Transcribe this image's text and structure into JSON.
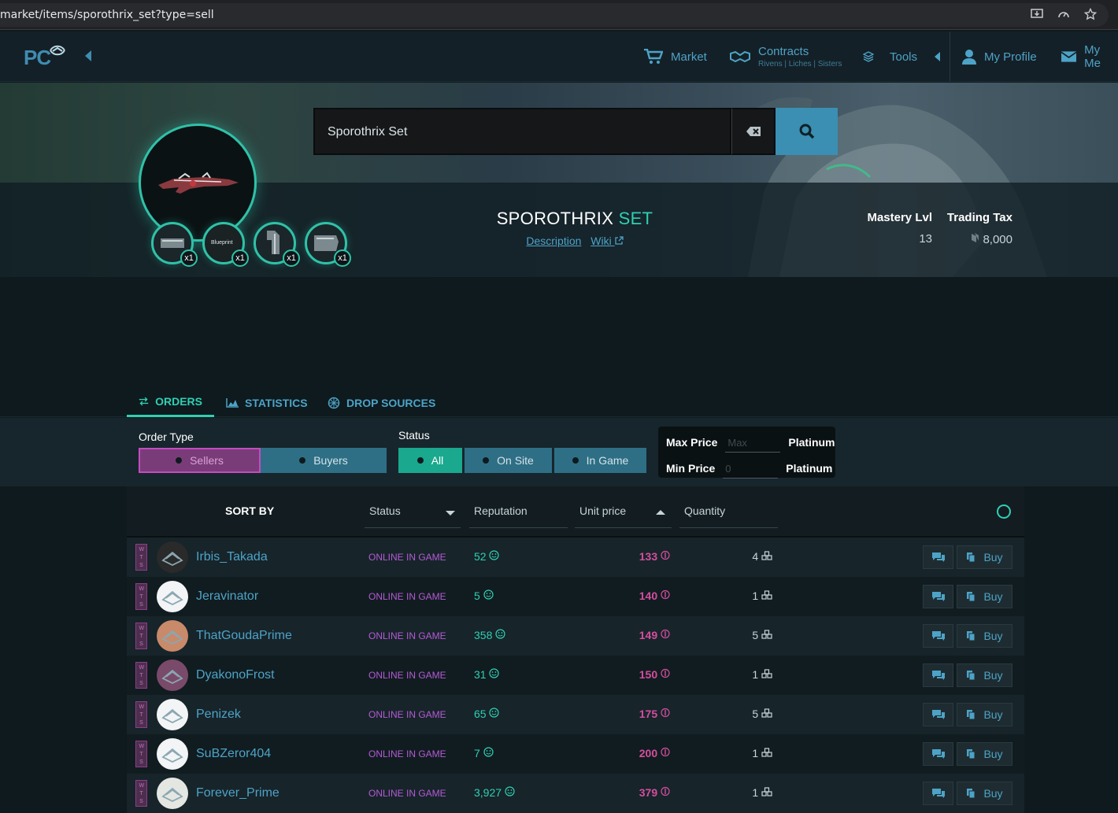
{
  "browser": {
    "url": "market/items/sporothrix_set?type=sell"
  },
  "nav": {
    "logo": "PC",
    "market": "Market",
    "contracts": "Contracts",
    "contracts_sub": "Rivens | Liches | Sisters",
    "tools": "Tools",
    "my_profile": "My Profile",
    "my_messages": "My Me"
  },
  "search": {
    "value": "Sporothrix Set"
  },
  "item": {
    "title_main": "SPOROTHRIX",
    "title_accent": "SET",
    "description_link": "Description",
    "wiki_link": "Wiki",
    "mastery_label": "Mastery Lvl",
    "mastery_value": "13",
    "tax_label": "Trading Tax",
    "tax_value": "8,000",
    "parts": [
      {
        "qty": "x1",
        "icon": "receiver-part-icon"
      },
      {
        "qty": "x1",
        "icon": "blueprint-part-icon",
        "text": "Blueprint"
      },
      {
        "qty": "x1",
        "icon": "stock-part-icon"
      },
      {
        "qty": "x1",
        "icon": "barrel-part-icon"
      }
    ]
  },
  "tabs": {
    "orders": "ORDERS",
    "statistics": "STATISTICS",
    "drop_sources": "DROP SOURCES"
  },
  "filters": {
    "order_type_label": "Order Type",
    "sellers": "Sellers",
    "buyers": "Buyers",
    "status_label": "Status",
    "all": "All",
    "on_site": "On Site",
    "in_game": "In Game",
    "max_price_label": "Max Price",
    "max_placeholder": "Max",
    "min_price_label": "Min Price",
    "min_placeholder": "0",
    "platinum": "Platinum"
  },
  "table": {
    "sort_by": "SORT BY",
    "col_status": "Status",
    "col_reputation": "Reputation",
    "col_unit_price": "Unit price",
    "col_quantity": "Quantity",
    "wts": "WTS",
    "buy_label": "Buy",
    "rows": [
      {
        "user": "Irbis_Takada",
        "status": "ONLINE IN GAME",
        "reputation": "52",
        "price": "133",
        "quantity": "4"
      },
      {
        "user": "Jeravinator",
        "status": "ONLINE IN GAME",
        "reputation": "5",
        "price": "140",
        "quantity": "1"
      },
      {
        "user": "ThatGoudaPrime",
        "status": "ONLINE IN GAME",
        "reputation": "358",
        "price": "149",
        "quantity": "5"
      },
      {
        "user": "DyakonoFrost",
        "status": "ONLINE IN GAME",
        "reputation": "31",
        "price": "150",
        "quantity": "1"
      },
      {
        "user": "Penizek",
        "status": "ONLINE IN GAME",
        "reputation": "65",
        "price": "175",
        "quantity": "5"
      },
      {
        "user": "SuBZeror404",
        "status": "ONLINE IN GAME",
        "reputation": "7",
        "price": "200",
        "quantity": "1"
      },
      {
        "user": "Forever_Prime",
        "status": "ONLINE IN GAME",
        "reputation": "3,927",
        "price": "379",
        "quantity": "1"
      }
    ]
  },
  "colors": {
    "accent": "#2fd0b3",
    "link": "#4da3c7",
    "price": "#d44e9f",
    "status": "#b55ad6"
  }
}
